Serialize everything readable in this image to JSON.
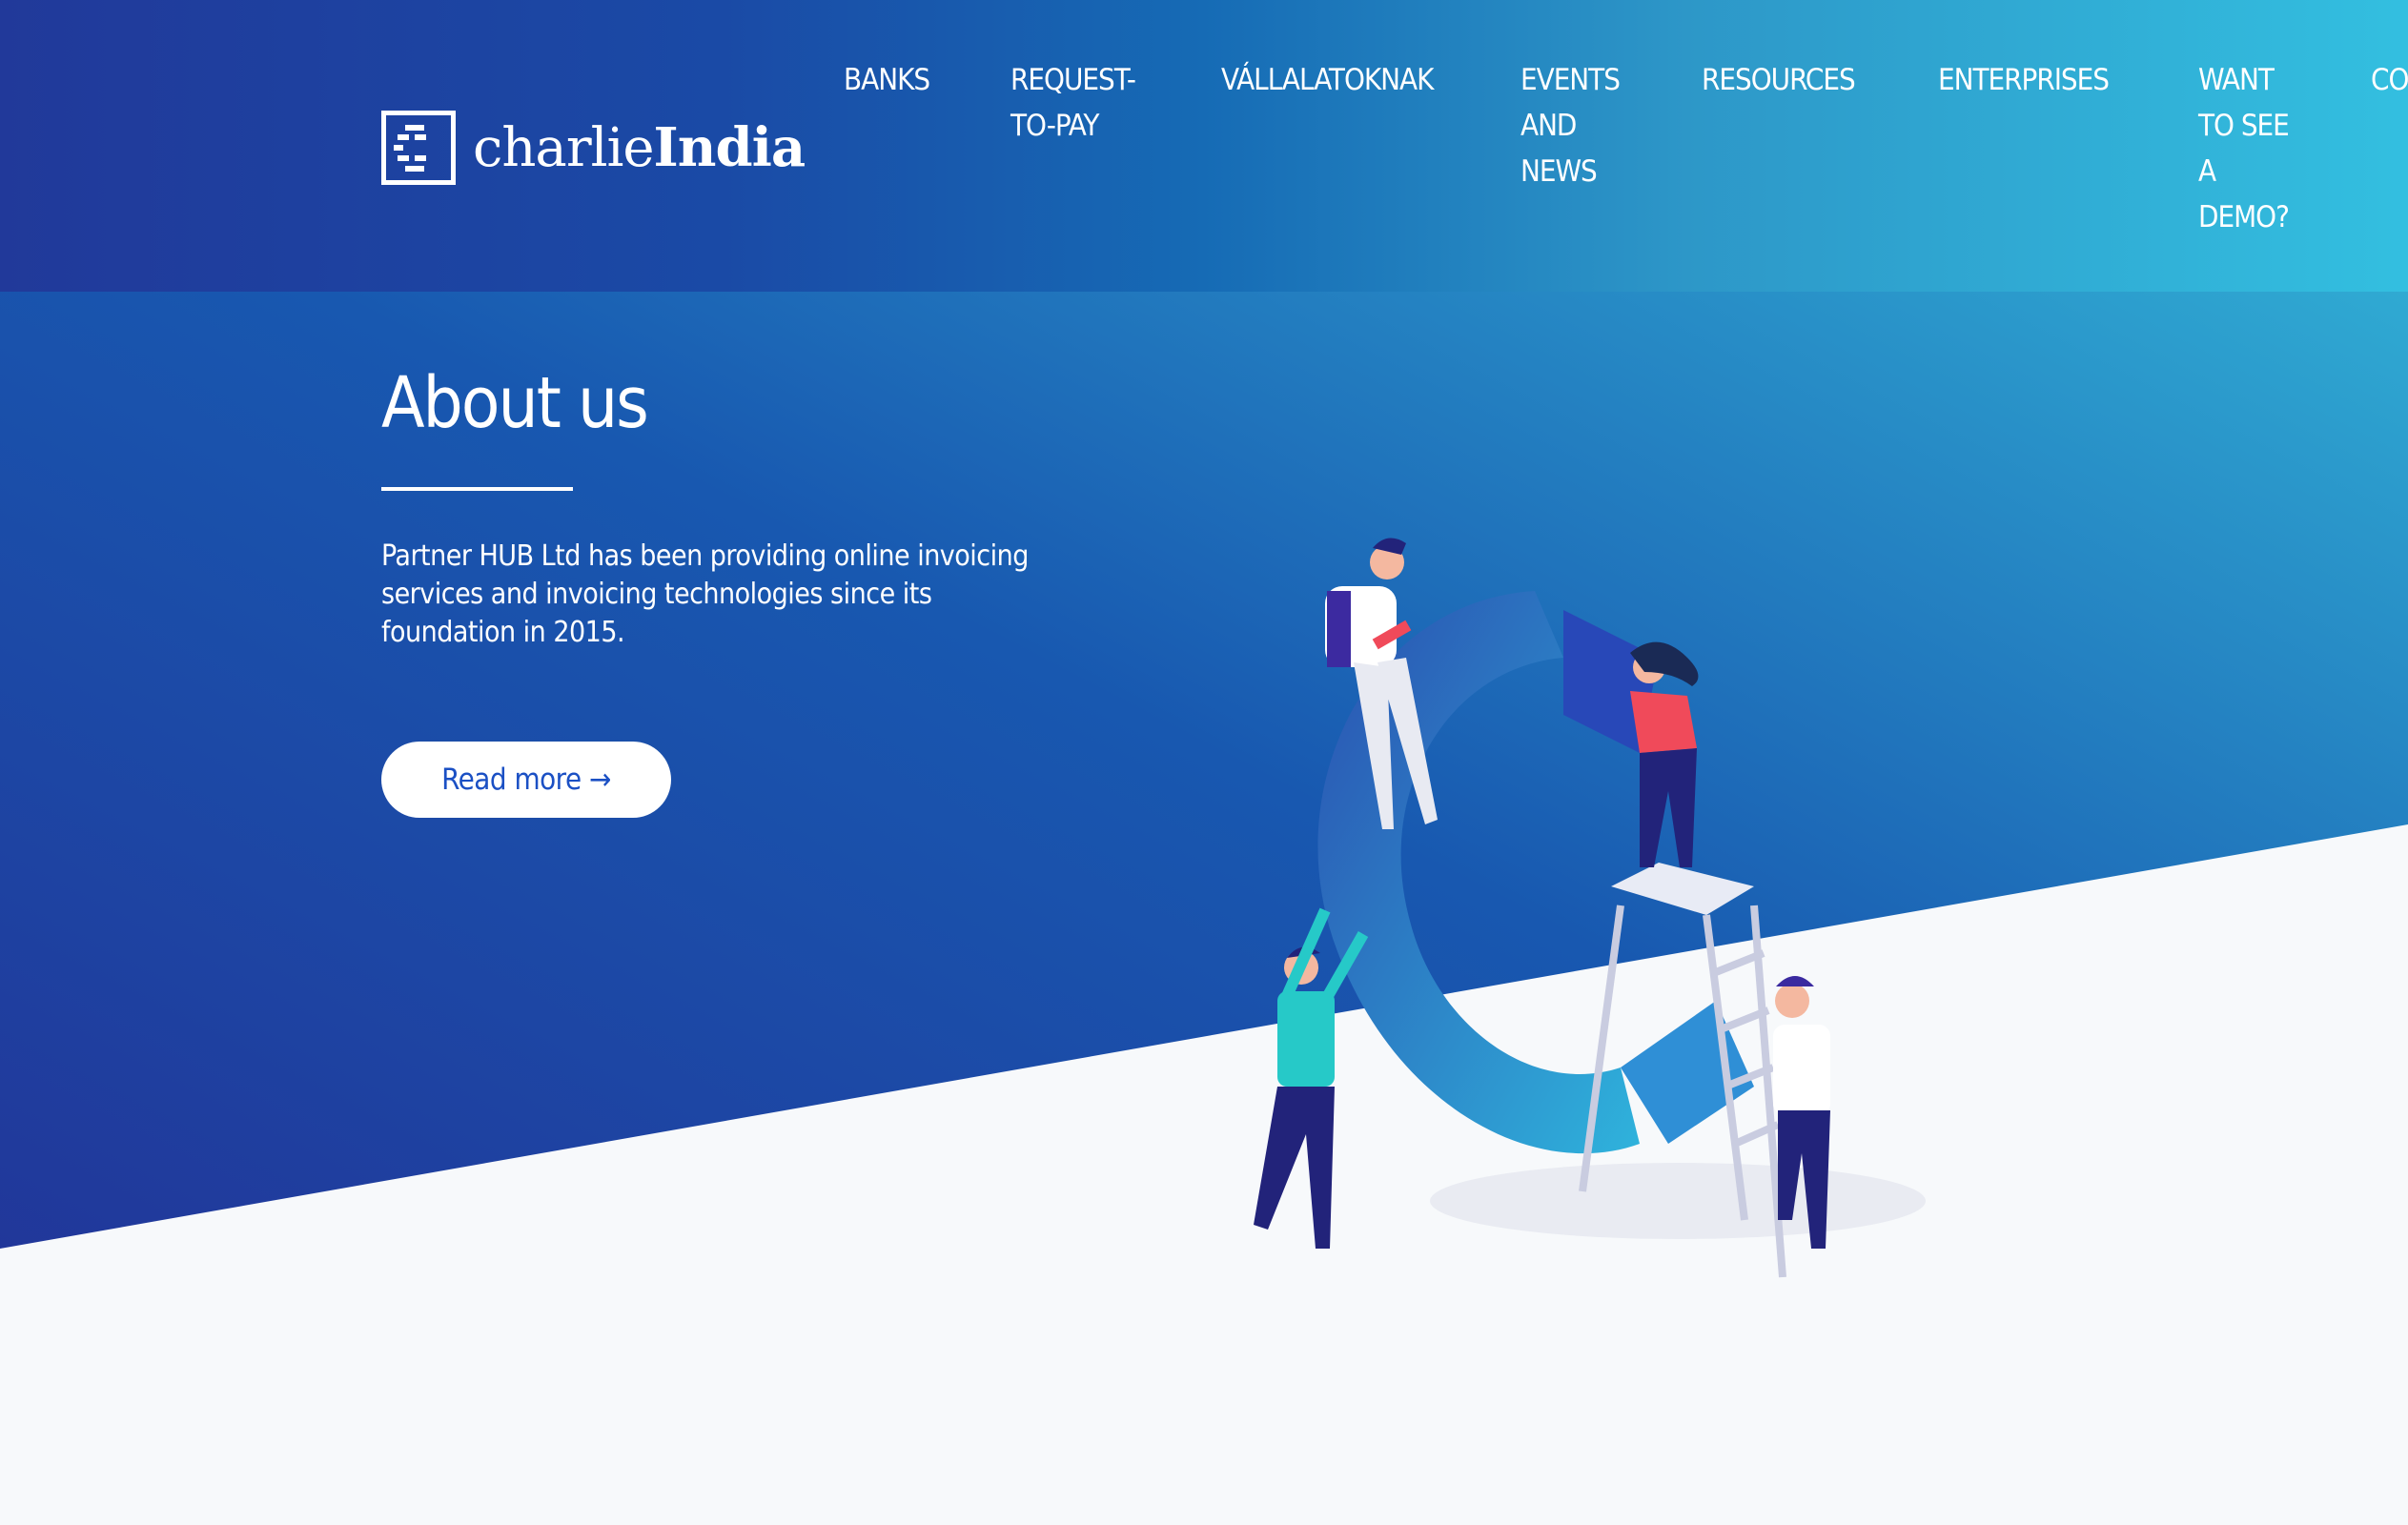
{
  "brand": {
    "name_light": "charlie",
    "name_bold": "India",
    "logo_icon": "bracket-c-icon"
  },
  "nav": {
    "items": [
      {
        "label": "BANKS"
      },
      {
        "label": "REQUEST-\nTO-PAY"
      },
      {
        "label": "VÁLLALATOKNAK"
      },
      {
        "label": "EVENTS\nAND\nNEWS"
      },
      {
        "label": "RESOURCES"
      },
      {
        "label": "ENTERPRISES"
      },
      {
        "label": "WANT\nTO SEE\nA\nDEMO?"
      },
      {
        "label": "CO"
      }
    ]
  },
  "hero": {
    "title": "About us",
    "description": "Partner HUB Ltd has been providing online invoicing services and invoicing technologies since its foundation in 2015.",
    "button_label": "Read more →"
  },
  "colors": {
    "gradient_start": "#21399a",
    "gradient_end": "#33bfe0",
    "button_text": "#1b50c4",
    "page_bg": "#f7f9fb"
  }
}
